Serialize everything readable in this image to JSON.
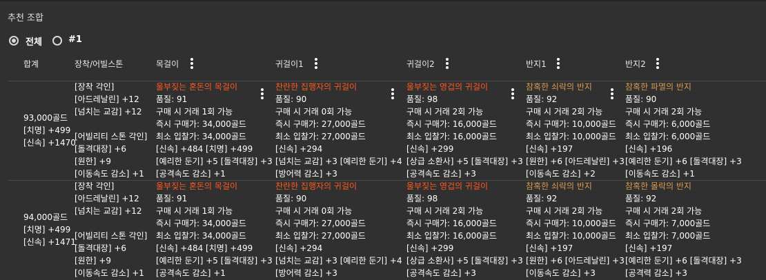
{
  "title": "추천 조합",
  "filter": {
    "options": [
      {
        "label": "전체",
        "selected": true
      },
      {
        "label": "#1",
        "selected": false
      }
    ]
  },
  "columns": [
    "합계",
    "장착/어빌스톤",
    "목걸이",
    "귀걸이1",
    "귀걸이2",
    "반지1",
    "반지2"
  ],
  "colors": {
    "accent_orange": "#ff5a1f",
    "accent_bronze": "#d79a52",
    "background": "#303030"
  },
  "icons": {
    "menu": "more-vert-icon",
    "radio": "radio-icon"
  },
  "rows": [
    {
      "total": [
        "93,000골드",
        "[치명] +499",
        "[신속] +1470"
      ],
      "engrave": [
        "[장착 각인]",
        "[아드레날린] +12",
        "[넘치는 교감] +12",
        "",
        "[어빌리티 스톤 각인]",
        "[돌격대장] +6",
        "[원한] +9",
        "[이동속도 감소] +1"
      ],
      "items": [
        {
          "name": "울부짖는 혼돈의 목걸이",
          "tone": "orange",
          "quality": "품질: 91",
          "trade": "구매 시 거래 1회 가능",
          "buy": "즉시 구매가: 34,000골드",
          "bid": "최소 입찰가: 34,000골드",
          "stats": "[신속] +484 [치명] +499",
          "eng1": "[예리한 둔기] +5 [돌격대장] +3",
          "eng2": "[공격속도 감소] +1"
        },
        {
          "name": "찬란한 집행자의 귀걸이",
          "tone": "orange",
          "quality": "품질: 90",
          "trade": "구매 시 거래 0회 가능",
          "buy": "즉시 구매가: 27,000골드",
          "bid": "최소 입찰가: 27,000골드",
          "stats": "[신속] +294",
          "eng1": "[넘치는 교감] +3 [예리한 둔기] +4",
          "eng2": "[방어력 감소] +3"
        },
        {
          "name": "울부짖는 영겁의 귀걸이",
          "tone": "orange",
          "quality": "품질: 98",
          "trade": "구매 시 거래 2회 가능",
          "buy": "즉시 구매가: 16,000골드",
          "bid": "최소 입찰가: 16,000골드",
          "stats": "[신속] +299",
          "eng1": "[상급 소환사] +5 [돌격대장] +3",
          "eng2": "[공격속도 감소] +3"
        },
        {
          "name": "참혹한 쇠락의 반지",
          "tone": "bronze",
          "quality": "품질: 92",
          "trade": "구매 시 거래 2회 가능",
          "buy": "즉시 구매가: 10,000골드",
          "bid": "최소 입찰가: 10,000골드",
          "stats": "[신속] +197",
          "eng1": "[원한] +6 [아드레날린] +3",
          "eng2": "[이동속도 감소] +2"
        },
        {
          "name": "참혹한 파멸의 반지",
          "tone": "bronze",
          "quality": "품질: 90",
          "trade": "구매 시 거래 2회 가능",
          "buy": "즉시 구매가: 6,000골드",
          "bid": "최소 입찰가: 6,000골드",
          "stats": "[신속] +196",
          "eng1": "[예리한 둔기] +6 [돌격대장] +3",
          "eng2": "[이동속도 감소] +1"
        }
      ]
    },
    {
      "total": [
        "94,000골드",
        "[치명] +499",
        "[신속] +1471"
      ],
      "engrave": [
        "[장착 각인]",
        "[아드레날린] +12",
        "[넘치는 교감] +12",
        "",
        "[어빌리티 스톤 각인]",
        "[돌격대장] +6",
        "[원한] +9",
        "[이동속도 감소] +1"
      ],
      "items": [
        {
          "name": "울부짖는 혼돈의 목걸이",
          "tone": "orange",
          "quality": "품질: 91",
          "trade": "구매 시 거래 1회 가능",
          "buy": "즉시 구매가: 34,000골드",
          "bid": "최소 입찰가: 34,000골드",
          "stats": "[신속] +484 [치명] +499",
          "eng1": "[예리한 둔기] +5 [돌격대장] +3",
          "eng2": "[공격속도 감소] +1"
        },
        {
          "name": "찬란한 집행자의 귀걸이",
          "tone": "orange",
          "quality": "품질: 90",
          "trade": "구매 시 거래 0회 가능",
          "buy": "즉시 구매가: 27,000골드",
          "bid": "최소 입찰가: 27,000골드",
          "stats": "[신속] +294",
          "eng1": "[넘치는 교감] +3 [예리한 둔기] +4",
          "eng2": "[방어력 감소] +3"
        },
        {
          "name": "울부짖는 영겁의 귀걸이",
          "tone": "orange",
          "quality": "품질: 98",
          "trade": "구매 시 거래 2회 가능",
          "buy": "즉시 구매가: 16,000골드",
          "bid": "최소 입찰가: 16,000골드",
          "stats": "[신속] +299",
          "eng1": "[상급 소환사] +5 [돌격대장] +3",
          "eng2": "[공격속도 감소] +3"
        },
        {
          "name": "참혹한 쇠락의 반지",
          "tone": "bronze",
          "quality": "품질: 92",
          "trade": "구매 시 거래 2회 가능",
          "buy": "즉시 구매가: 10,000골드",
          "bid": "최소 입찰가: 10,000골드",
          "stats": "[신속] +197",
          "eng1": "[원한] +6 [아드레날린] +3",
          "eng2": "[이동속도 감소] +3"
        },
        {
          "name": "참혹한 몰락의 반지",
          "tone": "bronze",
          "quality": "품질: 92",
          "trade": "구매 시 거래 2회 가능",
          "buy": "즉시 구매가: 7,000골드",
          "bid": "최소 입찰가: 7,000골드",
          "stats": "[신속] +197",
          "eng1": "[예리한 둔기] +6 [돌격대장] +3",
          "eng2": "[공격력 감소] +3"
        }
      ]
    }
  ]
}
